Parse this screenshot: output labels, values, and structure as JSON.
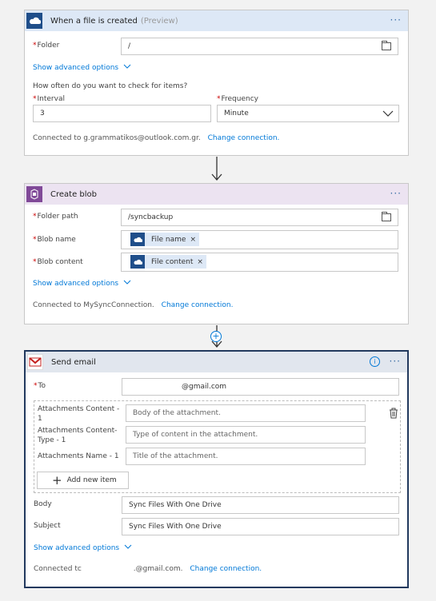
{
  "trigger": {
    "title": "When a file is created",
    "subtitle": "(Preview)",
    "more": "···",
    "folder_label": "Folder",
    "folder_value": "/",
    "advanced": "Show advanced options",
    "how_often": "How often do you want to check for items?",
    "interval_label": "Interval",
    "interval_value": "3",
    "frequency_label": "Frequency",
    "frequency_value": "Minute",
    "connected": "Connected to g.grammatikos@outlook.com.gr.",
    "change": "Change connection."
  },
  "blob": {
    "title": "Create blob",
    "more": "···",
    "folder_label": "Folder path",
    "folder_value": "/syncbackup",
    "name_label": "Blob name",
    "name_token": "File name",
    "content_label": "Blob content",
    "content_token": "File content",
    "token_remove": "×",
    "advanced": "Show advanced options",
    "connected": "Connected to MySyncConnection.",
    "change": "Change connection."
  },
  "email": {
    "title": "Send email",
    "more": "···",
    "info": "i",
    "to_label": "To",
    "to_value": "@gmail.com",
    "att_content_label": "Attachments Content - 1",
    "att_content_ph": "Body of the attachment.",
    "att_type_label": "Attachments Content-Type - 1",
    "att_type_ph": "Type of content in the attachment.",
    "att_name_label": "Attachments Name - 1",
    "att_name_ph": "Title of the attachment.",
    "add_new": "Add new item",
    "body_label": "Body",
    "body_value": "Sync Files With One Drive",
    "subject_label": "Subject",
    "subject_value": "Sync Files With One Drive",
    "advanced": "Show advanced options",
    "connected": "Connected tc",
    "connected_account": ".@gmail.com.",
    "change": "Change connection."
  },
  "colors": {
    "onedrive_header": "#dde8f6",
    "blob_header": "#ece3f1",
    "email_header": "#e1e6ee",
    "link": "#0078d7"
  }
}
